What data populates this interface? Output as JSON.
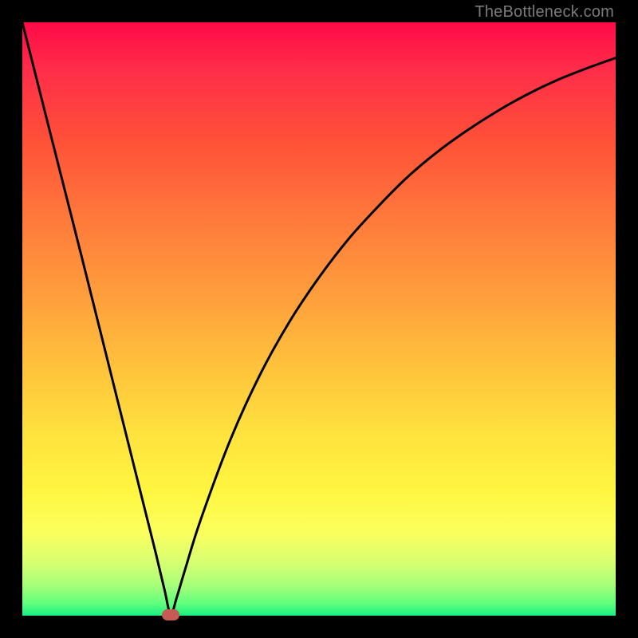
{
  "watermark": "TheBottleneck.com",
  "chart_data": {
    "type": "line",
    "title": "",
    "xlabel": "",
    "ylabel": "",
    "xlim": [
      0,
      100
    ],
    "ylim": [
      0,
      100
    ],
    "grid": false,
    "legend": false,
    "series": [
      {
        "name": "curve",
        "x": [
          0,
          5,
          10,
          15,
          20,
          22.5,
          24,
          25,
          26,
          27.5,
          30,
          35,
          40,
          45,
          50,
          55,
          60,
          65,
          70,
          75,
          80,
          85,
          90,
          95,
          100
        ],
        "values": [
          100,
          80.2,
          60.5,
          40.5,
          20.5,
          10.5,
          4.2,
          0.2,
          3.0,
          8.0,
          16.0,
          29.5,
          40.5,
          49.5,
          57.0,
          63.5,
          69.0,
          74.0,
          78.2,
          81.8,
          85.0,
          87.8,
          90.2,
          92.2,
          94.0
        ]
      }
    ],
    "marker": {
      "x": 25.0,
      "y": 0.2,
      "color": "#c85a56"
    },
    "background_gradient": {
      "top": "#ff0a46",
      "bottom": "#17ee80"
    }
  }
}
